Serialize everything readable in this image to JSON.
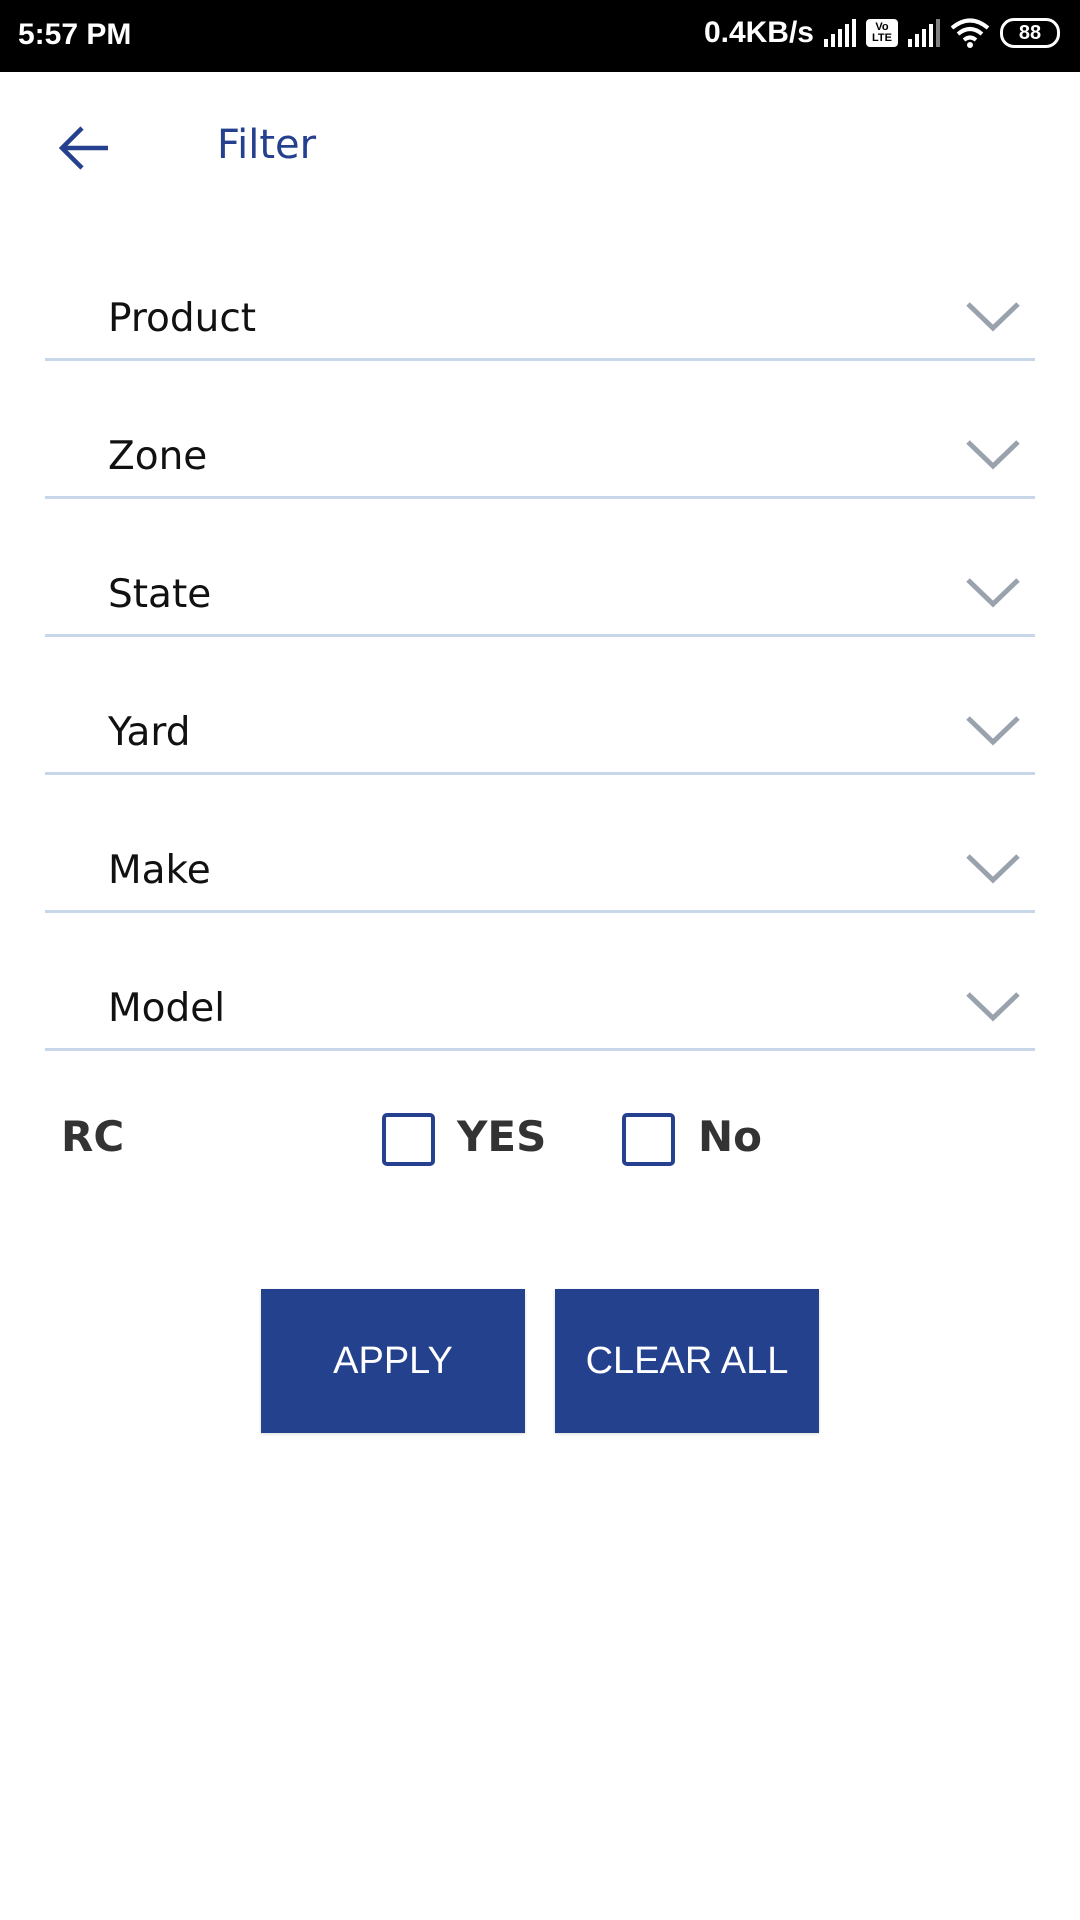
{
  "status_bar": {
    "time": "5:57 PM",
    "network_speed": "0.4KB/s",
    "volte": "Vo LTE",
    "battery": "88"
  },
  "header": {
    "title": "Filter",
    "back_icon": "arrow-left-icon"
  },
  "filters": [
    {
      "label": "Product"
    },
    {
      "label": "Zone"
    },
    {
      "label": "State"
    },
    {
      "label": "Yard"
    },
    {
      "label": "Make"
    },
    {
      "label": "Model"
    }
  ],
  "rc": {
    "label": "RC",
    "options": [
      {
        "label": "YES",
        "checked": false
      },
      {
        "label": "No",
        "checked": false
      }
    ]
  },
  "buttons": {
    "apply": "APPLY",
    "clear_all": "CLEAR ALL"
  },
  "colors": {
    "accent": "#24418e",
    "divider": "#c8d6ea"
  }
}
